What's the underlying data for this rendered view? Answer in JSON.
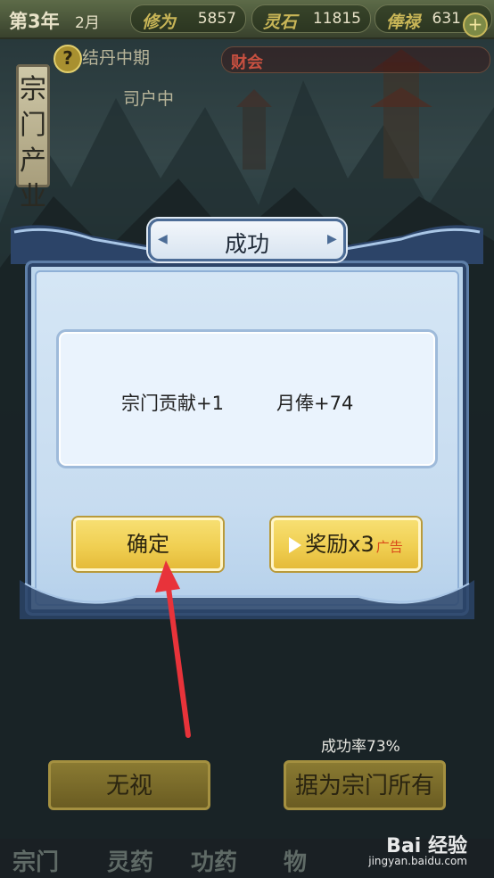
{
  "topbar": {
    "year": "第3年",
    "month": "2月",
    "resources": [
      {
        "key": "修为",
        "value": "5857"
      },
      {
        "key": "灵石",
        "value": "11815"
      },
      {
        "key": "俸禄",
        "value": "631"
      }
    ],
    "plus_label": "+"
  },
  "side_tag": {
    "label": "宗门产业"
  },
  "background": {
    "help_icon": "?",
    "line1": "结丹中期",
    "line2": "司户中",
    "red_pill_label": "财会",
    "ignore_button": "无视",
    "claim_button": "据为宗门所有",
    "success_rate": "成功率73%",
    "bottom_tabs": [
      "宗门",
      "灵药",
      "功药",
      "物"
    ]
  },
  "dialog": {
    "title": "成功",
    "rewards": [
      "宗门贡献+1",
      "月俸+74"
    ],
    "confirm_label": "确定",
    "reward_x3_label": "奖励x3",
    "ad_label": "广告"
  },
  "watermark": {
    "brand": "Bai 经验",
    "url": "jingyan.baidu.com"
  },
  "colors": {
    "gold": "#f0cf52",
    "dialog_bg": "#c7dcf0",
    "frame_blue": "#5e7fa8",
    "arrow_red": "#e8333a"
  }
}
